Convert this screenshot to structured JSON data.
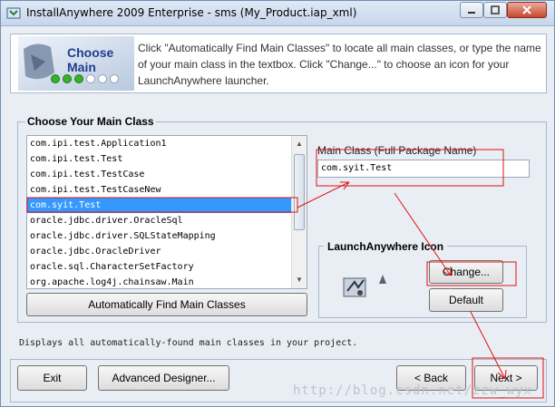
{
  "window": {
    "title": "InstallAnywhere 2009 Enterprise - sms (My_Product.iap_xml)",
    "controls": [
      "minimize-icon",
      "maximize-icon",
      "close-icon"
    ]
  },
  "header": {
    "logo_title": "Choose Main",
    "progress_steps": [
      true,
      true,
      true,
      false,
      false,
      false
    ],
    "instructions": "Click \"Automatically Find Main Classes\" to locate all main classes, or type the name of your main class in the textbox. Click \"Change...\" to choose an icon for your LaunchAnywhere launcher."
  },
  "main_class_group": {
    "label": "Choose Your Main Class",
    "classes": [
      "com.ipi.test.Application1",
      "com.ipi.test.Test",
      "com.ipi.test.TestCase",
      "com.ipi.test.TestCaseNew",
      "com.syit.Test",
      "oracle.jdbc.driver.OracleSql",
      "oracle.jdbc.driver.SQLStateMapping",
      "oracle.jdbc.OracleDriver",
      "oracle.sql.CharacterSetFactory",
      "org.apache.log4j.chainsaw.Main"
    ],
    "selected_index": 4,
    "find_button": "Automatically Find Main Classes",
    "main_class_label": "Main Class (Full Package Name)",
    "main_class_value": "com.syit.Test"
  },
  "launch_anywhere": {
    "label": "LaunchAnywhere Icon",
    "change_button": "Change...",
    "default_button": "Default"
  },
  "status_text": "Displays all automatically-found main classes in your project.",
  "footer": {
    "exit": "Exit",
    "advanced": "Advanced Designer...",
    "back": "< Back",
    "next": "Next >"
  },
  "watermark": "http://blog.csdn.net/zzw_wyx",
  "colors": {
    "selection": "#3399ff",
    "annotation_red": "#e01010",
    "progress_green": "#36b32a"
  }
}
